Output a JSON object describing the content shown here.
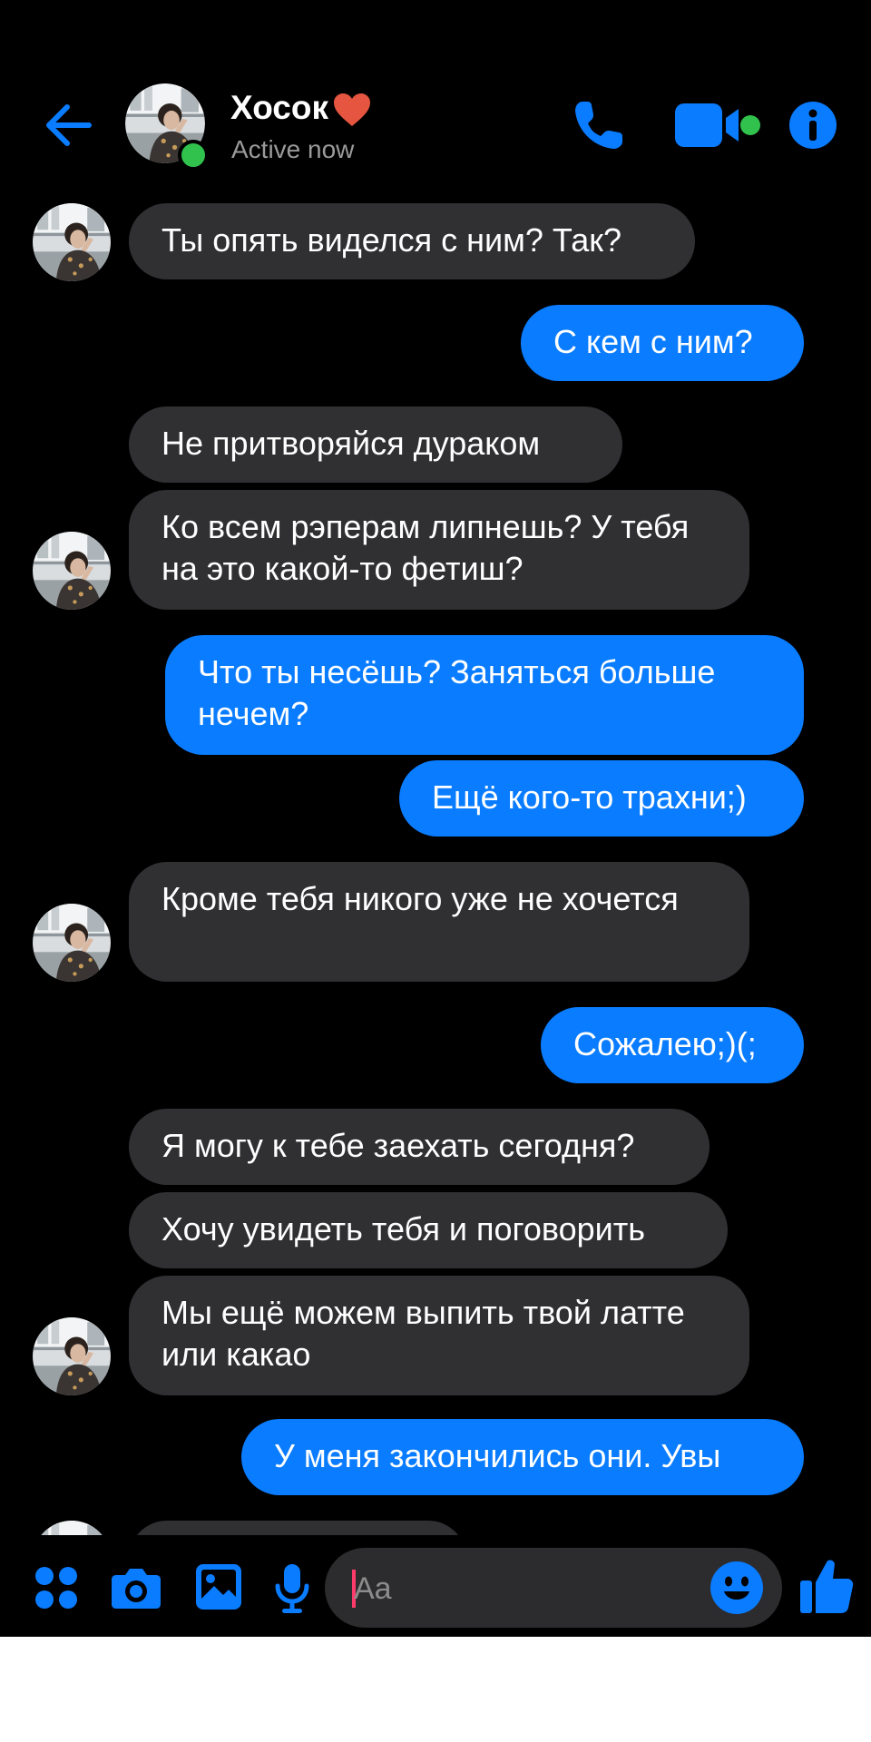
{
  "header": {
    "contact_name": "Хосок",
    "status": "Active now"
  },
  "messages": [
    {
      "side": "received",
      "text": "Ты опять виделся с ним? Так?"
    },
    {
      "side": "sent",
      "text": "С кем с ним?"
    },
    {
      "side": "received",
      "text": "Не притворяйся дураком"
    },
    {
      "side": "received",
      "text": "Ко всем рэперам липнешь? У тебя на это какой-то фетиш?"
    },
    {
      "side": "sent",
      "text": "Что ты несёшь? Заняться больше нечем?"
    },
    {
      "side": "sent",
      "text": "Ещё кого-то трахни;)"
    },
    {
      "side": "received",
      "text": "Кроме тебя никого уже не хочется"
    },
    {
      "side": "sent",
      "text": "Сожалею;)(;"
    },
    {
      "side": "received",
      "text": "Я могу к тебе заехать сегодня?"
    },
    {
      "side": "received",
      "text": "Хочу увидеть тебя и поговорить"
    },
    {
      "side": "received",
      "text": "Мы ещё можем выпить твой латте или какао"
    },
    {
      "side": "sent",
      "text": "У меня закончились они. Увы"
    }
  ],
  "composer": {
    "placeholder": "Aa"
  },
  "icons": {
    "back": "arrow-left-icon",
    "call": "phone-icon",
    "video": "video-camera-icon",
    "info": "info-icon",
    "apps": "four-dots-icon",
    "camera": "camera-icon",
    "gallery": "image-icon",
    "voice": "microphone-icon",
    "emoji": "smiley-icon",
    "like": "thumbs-up-icon"
  },
  "colors": {
    "accent": "#0a7cff",
    "received_bubble": "#303033",
    "background": "#000000",
    "online": "#31c24d",
    "heart": "#e5553f"
  }
}
